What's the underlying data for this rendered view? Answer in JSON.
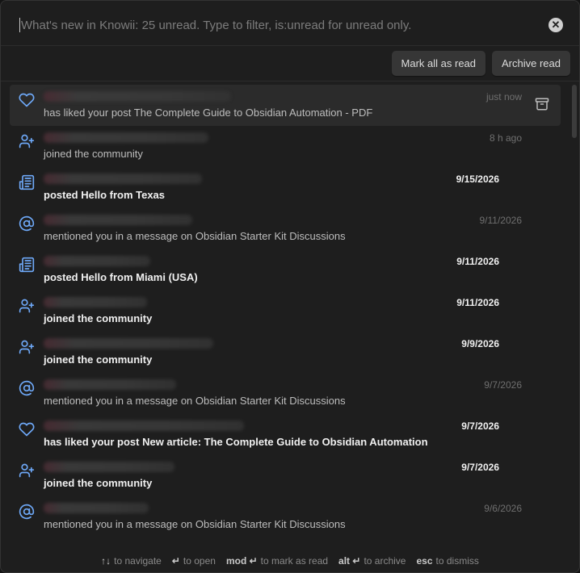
{
  "search": {
    "placeholder": "What's new in Knowii: 25 unread. Type to filter, is:unread for unread only.",
    "value": ""
  },
  "toolbar": {
    "mark_all_label": "Mark all as read",
    "archive_label": "Archive read"
  },
  "icons": {
    "like": "heart-icon",
    "join": "user-plus-icon",
    "post": "newspaper-icon",
    "mention": "at-sign-icon",
    "archive": "archive-box-icon",
    "clear": "close-circle-icon"
  },
  "colors": {
    "accent": "#6ea8f7",
    "background": "#1e1e1e",
    "selected_row": "#2b2b2b"
  },
  "notifications": [
    {
      "icon": "like",
      "description": "has liked your post The Complete Guide to Obsidian Automation - PDF",
      "time": "just now",
      "unread": false,
      "selected": true
    },
    {
      "icon": "join",
      "description": "joined the community",
      "time": "8 h ago",
      "unread": false
    },
    {
      "icon": "post",
      "description": "posted Hello from Texas",
      "time": "9/15/2026",
      "unread": true
    },
    {
      "icon": "mention",
      "description": "mentioned you in a message on Obsidian Starter Kit Discussions",
      "time": "9/11/2026",
      "unread": false
    },
    {
      "icon": "post",
      "description": "posted Hello from Miami (USA)",
      "time": "9/11/2026",
      "unread": true
    },
    {
      "icon": "join",
      "description": "joined the community",
      "time": "9/11/2026",
      "unread": true
    },
    {
      "icon": "join",
      "description": "joined the community",
      "time": "9/9/2026",
      "unread": true
    },
    {
      "icon": "mention",
      "description": "mentioned you in a message on Obsidian Starter Kit Discussions",
      "time": "9/7/2026",
      "unread": false
    },
    {
      "icon": "like",
      "description": "has liked your post New article: The Complete Guide to Obsidian Automation",
      "time": "9/7/2026",
      "unread": true
    },
    {
      "icon": "join",
      "description": "joined the community",
      "time": "9/7/2026",
      "unread": true
    },
    {
      "icon": "mention",
      "description": "mentioned you in a message on Obsidian Starter Kit Discussions",
      "time": "9/6/2026",
      "unread": false
    }
  ],
  "footer": {
    "hints": [
      {
        "key": "↑↓",
        "text": "to navigate"
      },
      {
        "key": "↵",
        "text": "to open"
      },
      {
        "key": "mod ↵",
        "text": "to mark as read"
      },
      {
        "key": "alt ↵",
        "text": "to archive"
      },
      {
        "key": "esc",
        "text": "to dismiss"
      }
    ]
  }
}
